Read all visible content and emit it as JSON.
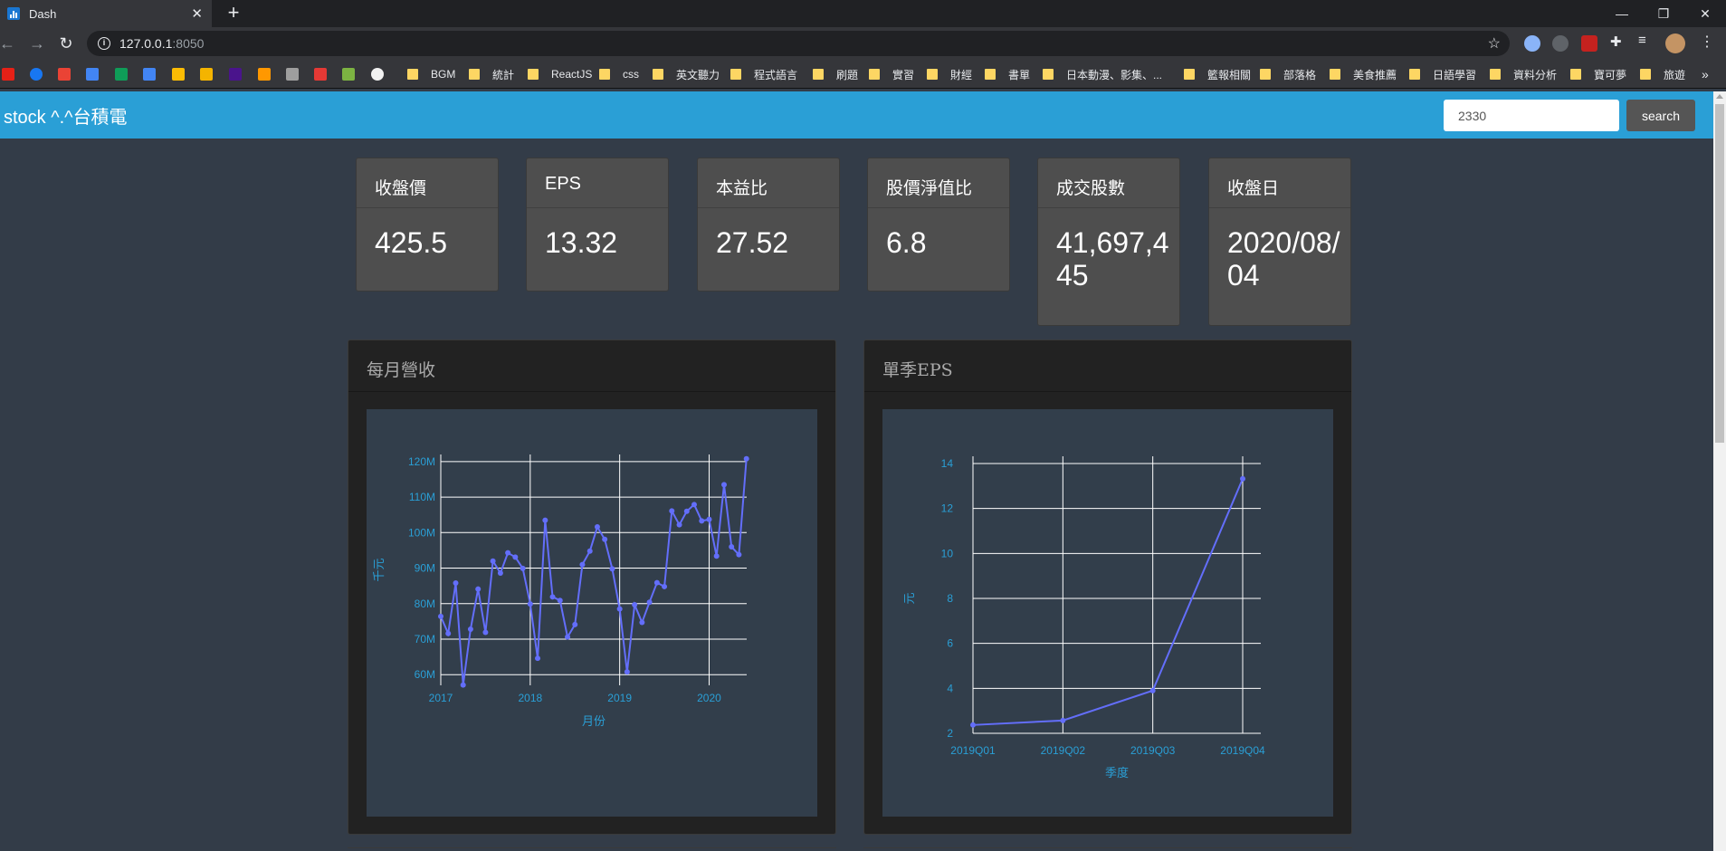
{
  "browser": {
    "tab_title": "Dash",
    "url_host": "127.0.0.1",
    "url_port": ":8050",
    "bookmarks": [
      "BGM",
      "統計",
      "ReactJS",
      "css",
      "英文聽力",
      "程式語言",
      "刷題",
      "實習",
      "財經",
      "書單",
      "日本動漫、影集、...",
      "籃報相關",
      "部落格",
      "美食推薦",
      "日語學習",
      "資料分析",
      "寶可夢",
      "旅遊"
    ]
  },
  "header": {
    "brand": "stock ^.^台積電",
    "search_value": "2330",
    "search_button": "search"
  },
  "cards": [
    {
      "label": "收盤價",
      "value": "425.5"
    },
    {
      "label": "EPS",
      "value": "13.32"
    },
    {
      "label": "本益比",
      "value": "27.52"
    },
    {
      "label": "股價淨值比",
      "value": "6.8"
    },
    {
      "label": "成交股數",
      "value": "41,697,445"
    },
    {
      "label": "收盤日",
      "value": "2020/08/04"
    }
  ],
  "panels": {
    "revenue_title": "每月營收",
    "eps_title": "單季EPS"
  },
  "colors": {
    "header_blue": "#2a9fd6",
    "line": "#636efa",
    "axis_text": "#2a9fd6"
  },
  "chart_data": [
    {
      "type": "line",
      "title": "每月營收",
      "xlabel": "月份",
      "ylabel": "千元",
      "xlim": [
        2017,
        2020.42
      ],
      "ylim": [
        57,
        122
      ],
      "x_ticks": [
        "2017",
        "2018",
        "2019",
        "2020"
      ],
      "y_ticks": [
        "60M",
        "70M",
        "80M",
        "90M",
        "100M",
        "110M",
        "120M"
      ],
      "x": [
        2017.0,
        2017.083,
        2017.167,
        2017.25,
        2017.333,
        2017.417,
        2017.5,
        2017.583,
        2017.667,
        2017.75,
        2017.833,
        2017.917,
        2018.0,
        2018.083,
        2018.167,
        2018.25,
        2018.333,
        2018.417,
        2018.5,
        2018.583,
        2018.667,
        2018.75,
        2018.833,
        2018.917,
        2019.0,
        2019.083,
        2019.167,
        2019.25,
        2019.333,
        2019.417,
        2019.5,
        2019.583,
        2019.667,
        2019.75,
        2019.833,
        2019.917,
        2020.0,
        2020.083,
        2020.167,
        2020.25,
        2020.333,
        2020.417
      ],
      "values": [
        76.4,
        71.6,
        85.8,
        57.1,
        72.8,
        84.1,
        71.9,
        92.0,
        88.6,
        94.3,
        93.1,
        89.9,
        79.9,
        64.6,
        103.5,
        81.9,
        80.9,
        70.6,
        74.1,
        91.0,
        94.8,
        101.6,
        98.1,
        89.8,
        78.5,
        60.8,
        79.7,
        74.7,
        80.4,
        85.9,
        84.8,
        106.1,
        102.2,
        106.0,
        107.9,
        103.3,
        103.7,
        93.4,
        113.5,
        96.0,
        93.8,
        120.8
      ]
    },
    {
      "type": "line",
      "title": "單季EPS",
      "xlabel": "季度",
      "ylabel": "元",
      "categories": [
        "2019Q01",
        "2019Q02",
        "2019Q03",
        "2019Q04"
      ],
      "y_ticks": [
        "2",
        "4",
        "6",
        "8",
        "10",
        "12",
        "14"
      ],
      "ylim": [
        2,
        14
      ],
      "values": [
        2.37,
        2.57,
        3.9,
        13.32
      ]
    }
  ]
}
